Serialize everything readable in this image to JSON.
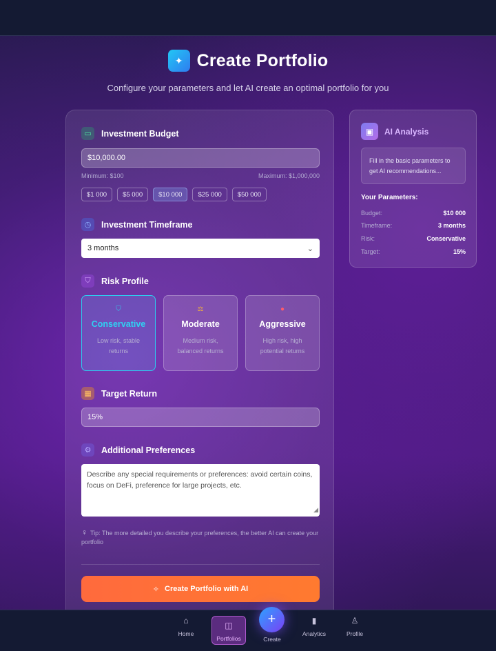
{
  "header": {
    "title": "Create Portfolio",
    "subtitle": "Configure your parameters and let AI create an optimal portfolio for you"
  },
  "budget": {
    "title": "Investment Budget",
    "value": "$10,000.00",
    "min_label": "Minimum: $100",
    "max_label": "Maximum: $1,000,000",
    "presets": [
      "$1 000",
      "$5 000",
      "$10 000",
      "$25 000",
      "$50 000"
    ],
    "selected_preset": "$10 000"
  },
  "timeframe": {
    "title": "Investment Timeframe",
    "selected": "3 months"
  },
  "risk": {
    "title": "Risk Profile",
    "options": [
      {
        "name": "Conservative",
        "desc": "Low risk, stable returns",
        "icon": "shield-icon",
        "color": "#2fd1f2"
      },
      {
        "name": "Moderate",
        "desc": "Medium risk, balanced returns",
        "icon": "scales-icon",
        "color": "#f3b23a"
      },
      {
        "name": "Aggressive",
        "desc": "High risk, high potential returns",
        "icon": "rocket-icon",
        "color": "#ff5b6b"
      }
    ],
    "selected": "Conservative"
  },
  "target": {
    "title": "Target Return",
    "value": "15%"
  },
  "preferences": {
    "title": "Additional Preferences",
    "placeholder": "Describe any special requirements or preferences: avoid certain coins, focus on DeFi, preference for large projects, etc.",
    "tip": "Tip: The more detailed you describe your preferences, the better AI can create your portfolio"
  },
  "cta": {
    "label": "Create Portfolio with AI"
  },
  "analysis": {
    "title": "AI Analysis",
    "message": "Fill in the basic parameters to get AI recommendations...",
    "params_title": "Your Parameters:",
    "params": [
      {
        "key": "Budget:",
        "value": "$10 000"
      },
      {
        "key": "Timeframe:",
        "value": "3 months"
      },
      {
        "key": "Risk:",
        "value": "Conservative"
      },
      {
        "key": "Target:",
        "value": "15%"
      }
    ]
  },
  "nav": {
    "home": "Home",
    "portfolios": "Portfolios",
    "create": "Create",
    "analytics": "Analytics",
    "profile": "Profile"
  },
  "colors": {
    "accent_cyan": "#2ecbee",
    "cta_orange": "#ff6a3d",
    "bar_bg": "#141a33"
  }
}
